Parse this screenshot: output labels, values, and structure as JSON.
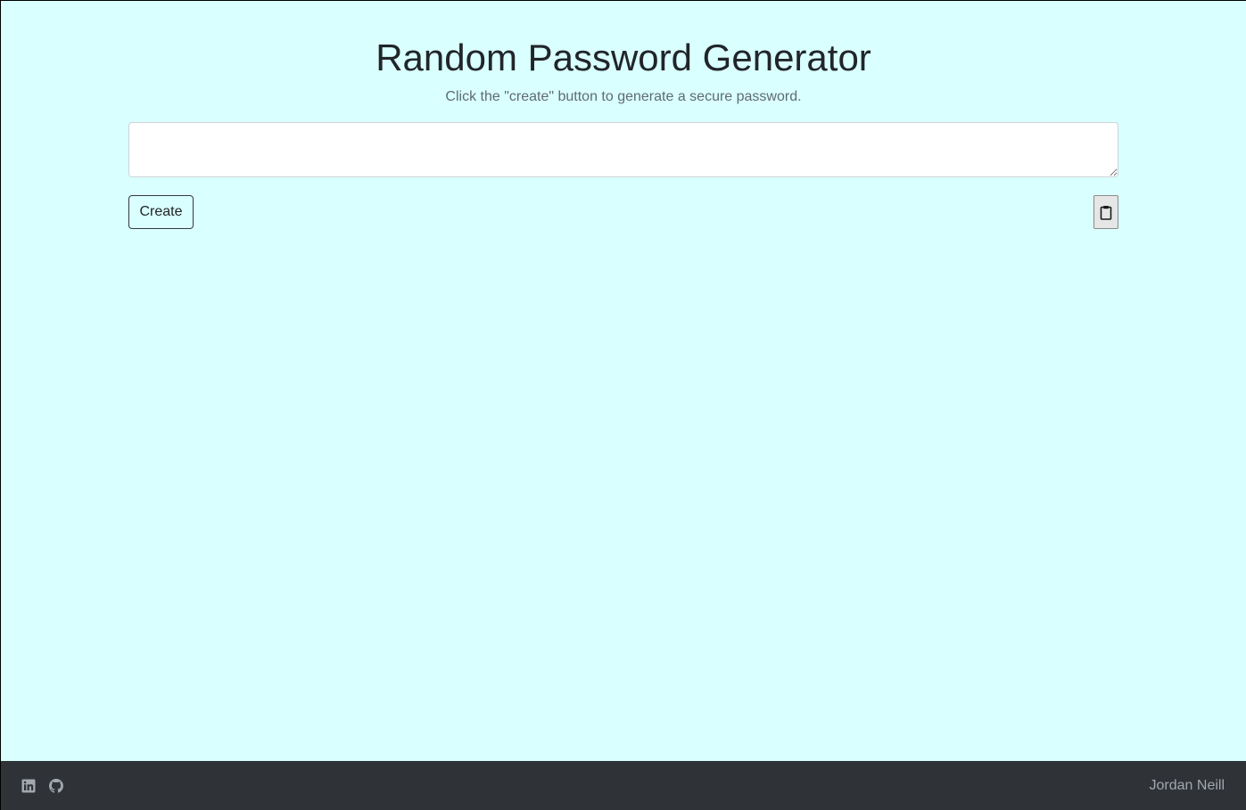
{
  "header": {
    "title": "Random Password Generator",
    "subtitle": "Click the \"create\" button to generate a secure password."
  },
  "password": {
    "value": "",
    "placeholder": ""
  },
  "actions": {
    "create_label": "Create",
    "copy_icon": "clipboard-icon"
  },
  "footer": {
    "icons": [
      "linkedin-icon",
      "github-icon"
    ],
    "author": "Jordan Neill"
  },
  "colors": {
    "background": "#d9ffff",
    "footer": "#2f3237",
    "title": "#212529",
    "subtitle": "#5f6b73",
    "footer_text": "#a2a8ad"
  }
}
